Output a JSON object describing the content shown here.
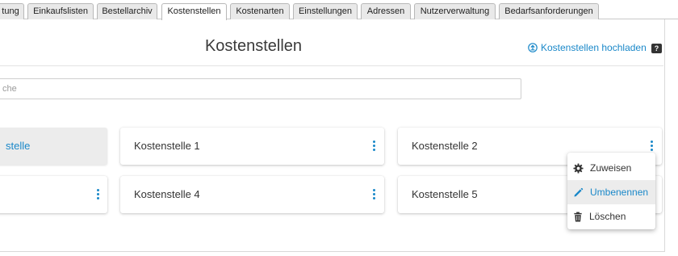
{
  "tabs": [
    {
      "label": "tung",
      "active": false
    },
    {
      "label": "Einkaufslisten",
      "active": false
    },
    {
      "label": "Bestellarchiv",
      "active": false
    },
    {
      "label": "Kostenstellen",
      "active": true
    },
    {
      "label": "Kostenarten",
      "active": false
    },
    {
      "label": "Einstellungen",
      "active": false
    },
    {
      "label": "Adressen",
      "active": false
    },
    {
      "label": "Nutzerverwaltung",
      "active": false
    },
    {
      "label": "Bedarfsanforderungen",
      "active": false
    }
  ],
  "page": {
    "title": "Kostenstellen",
    "upload_label": "Kostenstellen hochladen",
    "help_label": "?",
    "search_placeholder": "che"
  },
  "cards": [
    {
      "label": "stelle",
      "selected": true
    },
    {
      "label": "Kostenstelle 1",
      "selected": false
    },
    {
      "label": "Kostenstelle 2",
      "selected": false
    },
    {
      "label": "",
      "selected": false
    },
    {
      "label": "Kostenstelle 4",
      "selected": false
    },
    {
      "label": "Kostenstelle 5",
      "selected": false
    }
  ],
  "context_menu": {
    "items": [
      {
        "label": "Zuweisen",
        "icon": "gear-icon",
        "highlighted": false
      },
      {
        "label": "Umbenennen",
        "icon": "pencil-icon",
        "highlighted": true
      },
      {
        "label": "Löschen",
        "icon": "trash-icon",
        "highlighted": false
      }
    ]
  },
  "colors": {
    "accent": "#1a88c9",
    "selected_card_bg": "#ececec",
    "tab_bg": "#e9e9e9"
  }
}
